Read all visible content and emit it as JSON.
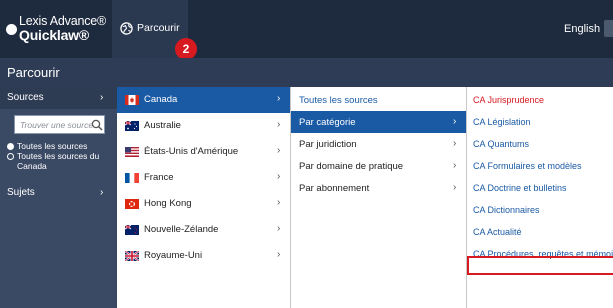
{
  "header": {
    "logo_line1": "Lexis Advance®",
    "logo_line2": "Quicklaw®",
    "tab_label": "Parcourir",
    "tab_icon": "globe-icon",
    "badge": "2",
    "language": "English"
  },
  "page_title": "Parcourir",
  "sidebar": {
    "sources_label": "Sources",
    "search_placeholder": "Trouver une source",
    "search_icon": "search-icon",
    "radio_all_sources": "Toutes les sources",
    "radio_all_canada_line1": "Toutes les sources du",
    "radio_all_canada_line2": "Canada",
    "subjects_label": "Sujets"
  },
  "countries": [
    {
      "label": "Canada",
      "flag": "canada-flag-icon",
      "selected": true
    },
    {
      "label": "Australie",
      "flag": "australia-flag-icon",
      "selected": false
    },
    {
      "label": "États-Unis d'Amérique",
      "flag": "usa-flag-icon",
      "selected": false
    },
    {
      "label": "France",
      "flag": "france-flag-icon",
      "selected": false
    },
    {
      "label": "Hong Kong",
      "flag": "hongkong-flag-icon",
      "selected": false
    },
    {
      "label": "Nouvelle-Zélande",
      "flag": "newzealand-flag-icon",
      "selected": false
    },
    {
      "label": "Royaume-Uni",
      "flag": "uk-flag-icon",
      "selected": false
    }
  ],
  "browse_modes": [
    {
      "label": "Toutes les sources",
      "selected": false,
      "chevron": false
    },
    {
      "label": "Par catégorie",
      "selected": true,
      "chevron": true
    },
    {
      "label": "Par juridiction",
      "selected": false,
      "chevron": true
    },
    {
      "label": "Par domaine de pratique",
      "selected": false,
      "chevron": true
    },
    {
      "label": "Par abonnement",
      "selected": false,
      "chevron": true
    }
  ],
  "categories": [
    {
      "label": "CA Jurisprudence",
      "red": true
    },
    {
      "label": "CA Législation",
      "red": false
    },
    {
      "label": "CA Quantums",
      "red": false
    },
    {
      "label": "CA Formulaires et modèles",
      "red": false
    },
    {
      "label": "CA Doctrine et bulletins",
      "red": false
    },
    {
      "label": "CA Dictionnaires",
      "red": false
    },
    {
      "label": "CA Actualité",
      "red": false
    },
    {
      "label": "CA Procédures, requêtes et mémoires",
      "red": false
    }
  ],
  "colors": {
    "topbar": "#1e2a3d",
    "sidebar": "#3b4a64",
    "selection": "#1a5aa5",
    "accent_red": "#d71920"
  }
}
